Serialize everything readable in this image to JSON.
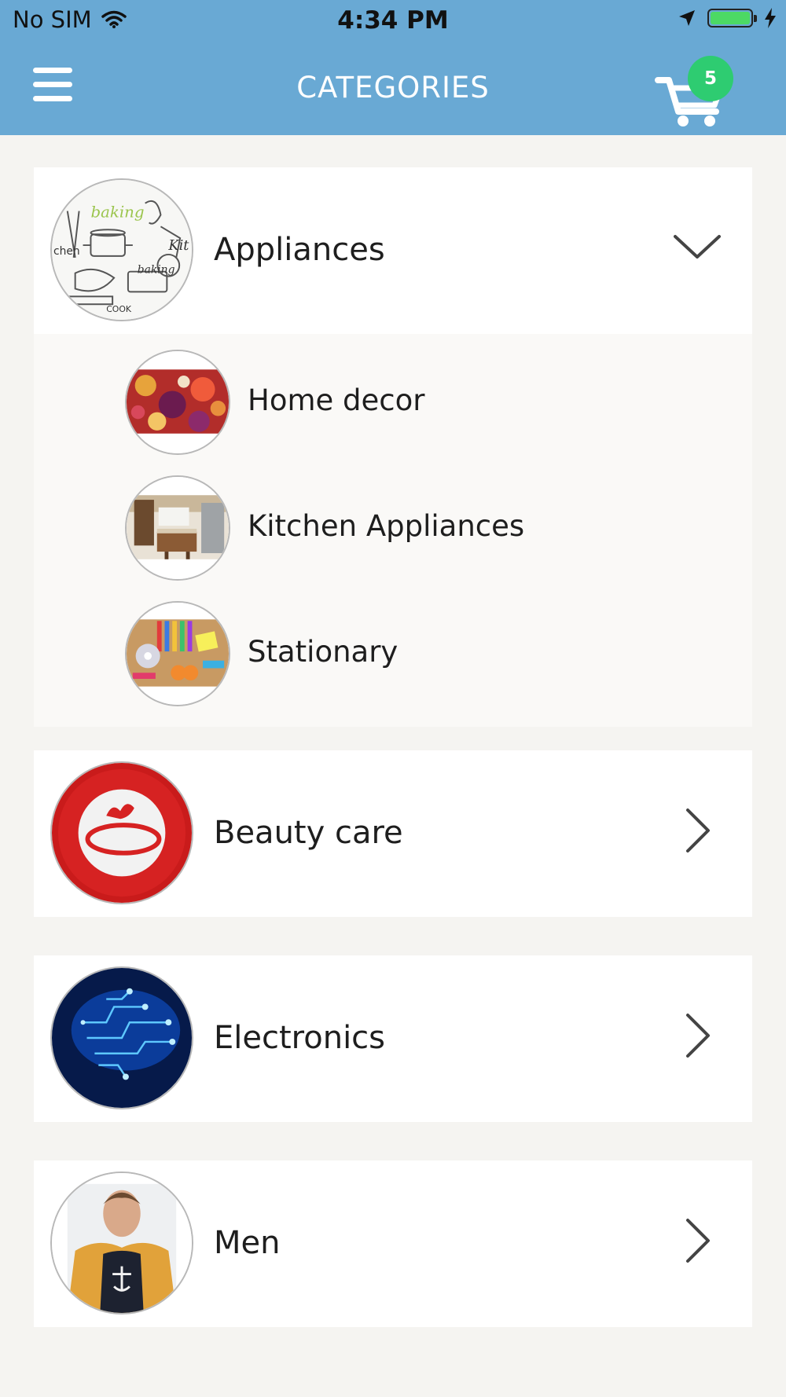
{
  "status_bar": {
    "carrier": "No SIM",
    "time": "4:34 PM",
    "wifi_icon": "wifi-icon",
    "location_icon": "location-arrow-icon",
    "battery_icon": "battery-full-icon",
    "charging_icon": "lightning-icon"
  },
  "header": {
    "title": "CATEGORIES",
    "menu_icon": "hamburger-menu-icon",
    "cart_icon": "shopping-cart-icon",
    "cart_count": "5",
    "bar_color": "#69a9d4",
    "badge_color": "#2ecc71"
  },
  "categories": [
    {
      "label": "Appliances",
      "expanded": true,
      "chevron_icon": "chevron-down-icon",
      "subcategories": [
        {
          "label": "Home decor"
        },
        {
          "label": "Kitchen Appliances"
        },
        {
          "label": "Stationary"
        }
      ]
    },
    {
      "label": "Beauty care",
      "expanded": false,
      "chevron_icon": "chevron-right-icon"
    },
    {
      "label": "Electronics",
      "expanded": false,
      "chevron_icon": "chevron-right-icon"
    },
    {
      "label": "Men",
      "expanded": false,
      "chevron_icon": "chevron-right-icon"
    }
  ]
}
